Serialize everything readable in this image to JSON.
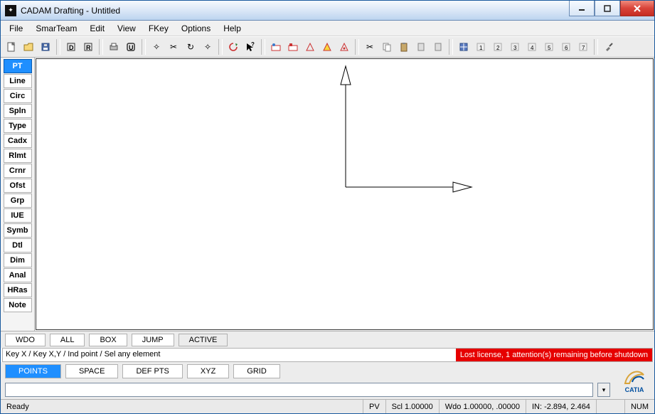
{
  "window": {
    "title": "CADAM Drafting - Untitled"
  },
  "menu": {
    "items": [
      "File",
      "SmarTeam",
      "Edit",
      "View",
      "FKey",
      "Options",
      "Help"
    ]
  },
  "side_tools": {
    "items": [
      "PT",
      "Line",
      "Circ",
      "Spln",
      "Type",
      "Cadx",
      "Rlmt",
      "Crnr",
      "Ofst",
      "Grp",
      "IUE",
      "Symb",
      "Dtl",
      "Dim",
      "Anal",
      "HRas",
      "Note"
    ],
    "active_index": 0
  },
  "bottom_tabs": {
    "items": [
      "WDO",
      "ALL",
      "BOX",
      "JUMP",
      "ACTIVE"
    ]
  },
  "prompt": {
    "text": "Key X / Key X,Y / Ind point / Sel any element"
  },
  "alert": {
    "text": "Lost license, 1 attention(s) remaining before shutdown"
  },
  "mode_tabs": {
    "items": [
      "POINTS",
      "SPACE",
      "DEF PTS",
      "XYZ",
      "GRID"
    ],
    "active_index": 0
  },
  "command_input": {
    "value": ""
  },
  "logo": {
    "brand": "CATIA"
  },
  "status": {
    "ready": "Ready",
    "pv": "PV",
    "scl": "Scl 1.00000",
    "wdo": "Wdo 1.00000, .00000",
    "in": "IN: -2.894, 2.464",
    "num": "NUM"
  }
}
